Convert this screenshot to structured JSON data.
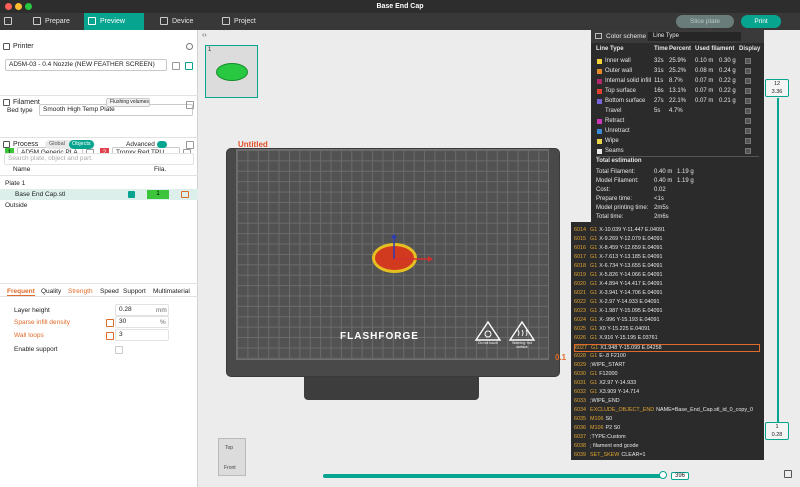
{
  "window": {
    "title": "Base End Cap"
  },
  "tabs": [
    {
      "label": "Prepare"
    },
    {
      "label": "Preview"
    },
    {
      "label": "Device"
    },
    {
      "label": "Project"
    }
  ],
  "toolbar": {
    "slice_label": "Slice plate",
    "print_label": "Print"
  },
  "printer": {
    "section_title": "Printer",
    "name": "AD5M-03 - 0.4 Nozzle (NEW FEATHER SCREEN)",
    "bed_type_label": "Bed type",
    "bed_type": "Smooth High Temp Plate"
  },
  "filament": {
    "section_title": "Filament",
    "flushing_label": "Flushing volumes",
    "items": [
      {
        "index": "1",
        "name": "AD5M Generic PLA",
        "color": "#3cc43a"
      },
      {
        "index": "2",
        "name": "Tronxy Red TPU",
        "color": "#e0414d"
      }
    ]
  },
  "process": {
    "section_title": "Process",
    "global_label": "Global",
    "objects_label": "Objects",
    "advanced_label": "Advanced",
    "search_placeholder": "Search plate, object and part.",
    "col_name": "Name",
    "col_fila": "Fila.",
    "plate": "Plate 1",
    "object": "Base End Cap.stl",
    "object_fila": "1",
    "outside": "Outside"
  },
  "settings_tabs": [
    {
      "label": "Frequent"
    },
    {
      "label": "Quality"
    },
    {
      "label": "Strength"
    },
    {
      "label": "Speed"
    },
    {
      "label": "Support"
    },
    {
      "label": "Multimaterial"
    }
  ],
  "settings": {
    "layer_height_label": "Layer height",
    "layer_height": "0.28",
    "layer_height_unit": "mm",
    "sparse_infill_label": "Sparse infill density",
    "sparse_infill": "30",
    "sparse_unit": "%",
    "wall_loops_label": "Wall loops",
    "wall_loops": "3",
    "enable_support_label": "Enable support"
  },
  "plate": {
    "label": "Untitled",
    "thumb_index": "1",
    "brand": "FLASHFORGE",
    "warn1": "Do not touch",
    "warn2": "Warning: hot surface"
  },
  "color_scheme": {
    "title": "Color scheme",
    "mode": "Line Type",
    "headers": [
      "Line Type",
      "Time",
      "Percent",
      "Used filament",
      "Display"
    ],
    "rows": [
      {
        "name": "Inner wall",
        "time": "32s",
        "percent": "25.9%",
        "len": "0.10 m",
        "weight": "0.30 g",
        "color": "#f2d33a"
      },
      {
        "name": "Outer wall",
        "time": "31s",
        "percent": "25.2%",
        "len": "0.08 m",
        "weight": "0.24 g",
        "color": "#e58a2a"
      },
      {
        "name": "Internal solid infill",
        "time": "11s",
        "percent": "8.7%",
        "len": "0.07 m",
        "weight": "0.22 g",
        "color": "#b3276b"
      },
      {
        "name": "Top surface",
        "time": "16s",
        "percent": "13.1%",
        "len": "0.07 m",
        "weight": "0.22 g",
        "color": "#e2412f"
      },
      {
        "name": "Bottom surface",
        "time": "27s",
        "percent": "22.1%",
        "len": "0.07 m",
        "weight": "0.21 g",
        "color": "#7b64d8"
      },
      {
        "name": "Travel",
        "time": "5s",
        "percent": "4.7%",
        "len": "",
        "weight": "",
        "color": ""
      },
      {
        "name": "Retract",
        "time": "",
        "percent": "",
        "len": "",
        "weight": "",
        "color": "#cc38b8"
      },
      {
        "name": "Unretract",
        "time": "",
        "percent": "",
        "len": "",
        "weight": "",
        "color": "#3a8ad8"
      },
      {
        "name": "Wipe",
        "time": "",
        "percent": "",
        "len": "",
        "weight": "",
        "color": "#e8d64a"
      },
      {
        "name": "Seams",
        "time": "",
        "percent": "",
        "len": "",
        "weight": "",
        "color": "#e8e8e8"
      }
    ],
    "total_title": "Total estimation",
    "totals": [
      {
        "label": "Total Filament:",
        "v1": "0.40 m",
        "v2": "1.19 g"
      },
      {
        "label": "Model Filament:",
        "v1": "0.40 m",
        "v2": "1.19 g"
      },
      {
        "label": "Cost:",
        "v1": "0.02",
        "v2": ""
      },
      {
        "label": "Prepare time:",
        "v1": "<1s",
        "v2": ""
      },
      {
        "label": "Model printing time:",
        "v1": "2m5s",
        "v2": ""
      },
      {
        "label": "Total time:",
        "v1": "2m6s",
        "v2": ""
      }
    ]
  },
  "gcode": [
    {
      "n": "6014",
      "c": "G1",
      "t": "X-10.039 Y-11.447 E.04091"
    },
    {
      "n": "6015",
      "c": "G1",
      "t": "X-9.269 Y-12.079 E.04091"
    },
    {
      "n": "6016",
      "c": "G1",
      "t": "X-8.459 Y-12.659 E.04091"
    },
    {
      "n": "6017",
      "c": "G1",
      "t": "X-7.613 Y-13.185 E.04091"
    },
    {
      "n": "6018",
      "c": "G1",
      "t": "X-6.734 Y-13.655 E.04091"
    },
    {
      "n": "6019",
      "c": "G1",
      "t": "X-5.826 Y-14.066 E.04091"
    },
    {
      "n": "6020",
      "c": "G1",
      "t": "X-4.894 Y-14.417 E.04091"
    },
    {
      "n": "6021",
      "c": "G1",
      "t": "X-3.941 Y-14.706 E.04091"
    },
    {
      "n": "6022",
      "c": "G1",
      "t": "X-2.97 Y-14.933 E.04091"
    },
    {
      "n": "6023",
      "c": "G1",
      "t": "X-1.987 Y-15.095 E.04091"
    },
    {
      "n": "6024",
      "c": "G1",
      "t": "X-.996 Y-15.193 E.04091"
    },
    {
      "n": "6025",
      "c": "G1",
      "t": "X0 Y-15.225 E.04091"
    },
    {
      "n": "6026",
      "c": "G1",
      "t": "X.916 Y-15.195 E.03761"
    },
    {
      "n": "6027",
      "c": "G1",
      "t": "X1.948 Y-15.099 E.04258"
    },
    {
      "n": "6028",
      "c": "G1",
      "t": "E-.8 F2100"
    },
    {
      "n": "6029",
      "c": "",
      "t": ";WIPE_START"
    },
    {
      "n": "6030",
      "c": "G1",
      "t": "F12000"
    },
    {
      "n": "6031",
      "c": "G1",
      "t": "X2.97 Y-14.933"
    },
    {
      "n": "6032",
      "c": "G1",
      "t": "X3.909 Y-14.714"
    },
    {
      "n": "6033",
      "c": "",
      "t": ";WIPE_END"
    },
    {
      "n": "6034",
      "c": "EXCLUDE_OBJECT_END",
      "t": "NAME=Base_End_Cap.stl_id_0_copy_0"
    },
    {
      "n": "6035",
      "c": "M106",
      "t": "S0"
    },
    {
      "n": "6036",
      "c": "M106",
      "t": "P2 S0"
    },
    {
      "n": "6037",
      "c": "",
      "t": ";TYPE:Custom"
    },
    {
      "n": "6038",
      "c": "",
      "t": "; filament end gcode"
    },
    {
      "n": "6039",
      "c": "SET_SKEW",
      "t": "CLEAR=1"
    }
  ],
  "sliders": {
    "layer_top": "12",
    "height_top": "3.36",
    "layer_bottom": "1",
    "height_bottom": "0.28",
    "move_value": "396"
  },
  "view_cube": {
    "top": "Top",
    "front": "Front"
  },
  "layer_marker": "0.1"
}
